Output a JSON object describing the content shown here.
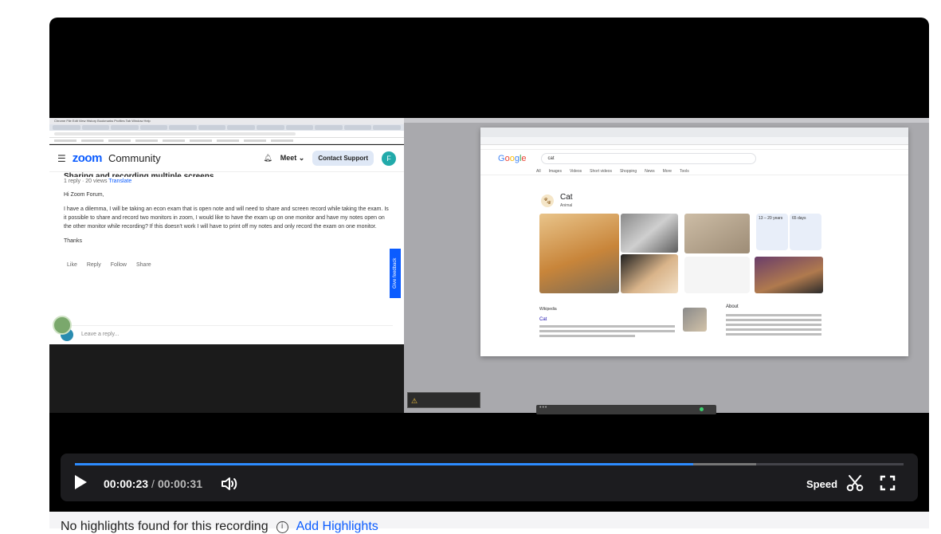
{
  "recording": {
    "left_capture": {
      "menubar": "Chrome  File  Edit  View  History  Bookmarks  Profiles  Tab  Window  Help",
      "zoom_logo": "zoom",
      "zoom_community": "Community",
      "meet_label": "Meet",
      "contact_support": "Contact Support",
      "avatar_letter": "F",
      "post_title": "Sharing and recording multiple screens",
      "post_meta_replies": "1 reply · 20 views",
      "post_meta_translate": "Translate",
      "greeting": "Hi Zoom Forum,",
      "body": "I have a dilemma, I will be taking an econ exam that is open note and will need to share and screen record while taking the exam. Is it possible to share and record two monitors in zoom, I would like to have the exam up on one monitor and have my notes open on the other monitor while recording? If this doesn't work I will have to print off my notes and only record the exam on one monitor.",
      "thanks": "Thanks",
      "actions": [
        "Like",
        "Reply",
        "Follow",
        "Share"
      ],
      "reply_placeholder": "Leave a reply...",
      "feedback_tab": "Give feedback"
    },
    "right_capture": {
      "google_search_value": "cat",
      "search_tabs": [
        "All",
        "Images",
        "Videos",
        "Short videos",
        "Shopping",
        "News",
        "More",
        "Tools"
      ],
      "kp_title": "Cat",
      "kp_subtitle": "Animal",
      "side_card_1": "13 – 20 years",
      "side_card_2": "65 days",
      "result_source": "Wikipedia",
      "result_title": "Cat",
      "about_title": "About"
    }
  },
  "player": {
    "current_time": "00:00:23",
    "separator": "/",
    "total_time": "00:00:31",
    "progress": 0.746,
    "buffered": 0.822,
    "speed_label": "Speed",
    "accent_color": "#2d8cff"
  },
  "highlights": {
    "message": "No highlights found for this recording",
    "add_label": "Add Highlights"
  }
}
